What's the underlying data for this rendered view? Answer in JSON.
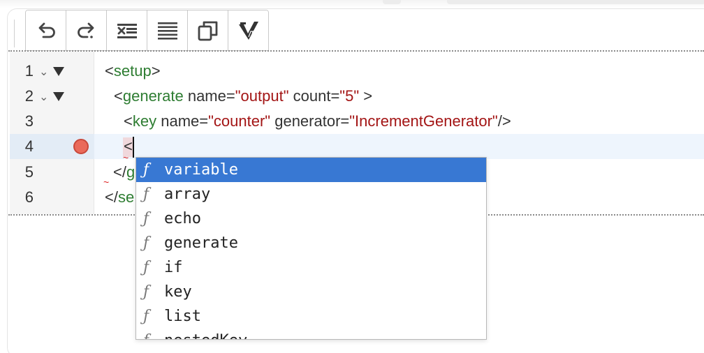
{
  "toolbar": {
    "buttons": [
      {
        "name": "undo-icon"
      },
      {
        "name": "redo-icon"
      },
      {
        "name": "clear-format-icon"
      },
      {
        "name": "format-lines-icon"
      },
      {
        "name": "copy-icon"
      },
      {
        "name": "vim-icon"
      }
    ]
  },
  "gutter": {
    "line_numbers": [
      "1",
      "2",
      "3",
      "4",
      "5",
      "6"
    ],
    "fold_marker": "⌄"
  },
  "code": {
    "line1": {
      "open": "<",
      "tag": "setup",
      "close": ">"
    },
    "line2": {
      "open": "<",
      "tag": "generate",
      "attr1": " name=",
      "val1": "\"output\"",
      "attr2": " count=",
      "val2": "\"5\"",
      "close": " >"
    },
    "line3": {
      "open": "<",
      "tag": "key",
      "attr1": " name=",
      "val1": "\"counter\"",
      "attr2": " generator=",
      "val2": "\"IncrementGenerator\"",
      "close": "/>"
    },
    "line4": {
      "text": "<"
    },
    "line5": {
      "open": "</",
      "tag": "g"
    },
    "line6": {
      "open": "</",
      "tag": "se"
    }
  },
  "autocomplete": {
    "kind_glyph": "ƒ",
    "items": [
      "variable",
      "array",
      "echo",
      "generate",
      "if",
      "key",
      "list",
      "nestedKey"
    ],
    "selected_index": 0
  },
  "colors": {
    "tag": "#2e7d32",
    "string": "#a31515",
    "selection": "#3878d3",
    "breakpoint": "#ea6a5a"
  }
}
